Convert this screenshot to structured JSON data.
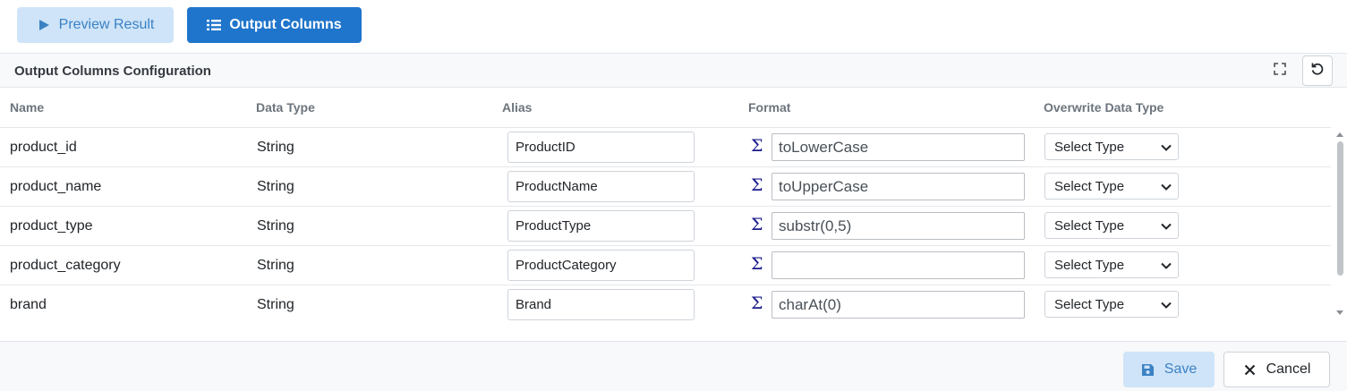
{
  "toolbar": {
    "preview_label": "Preview Result",
    "output_label": "Output Columns"
  },
  "panel": {
    "title": "Output Columns Configuration",
    "headers": {
      "name": "Name",
      "data_type": "Data Type",
      "alias": "Alias",
      "format": "Format",
      "overwrite": "Overwrite Data Type"
    }
  },
  "rows": [
    {
      "name": "product_id",
      "data_type": "String",
      "alias": "ProductID",
      "format": "toLowerCase",
      "overwrite": "Select Type"
    },
    {
      "name": "product_name",
      "data_type": "String",
      "alias": "ProductName",
      "format": "toUpperCase",
      "overwrite": "Select Type"
    },
    {
      "name": "product_type",
      "data_type": "String",
      "alias": "ProductType",
      "format": "substr(0,5)",
      "overwrite": "Select Type"
    },
    {
      "name": "product_category",
      "data_type": "String",
      "alias": "ProductCategory",
      "format": "",
      "overwrite": "Select Type"
    },
    {
      "name": "brand",
      "data_type": "String",
      "alias": "Brand",
      "format": "charAt(0)",
      "overwrite": "Select Type"
    }
  ],
  "sigma_symbol": "Σ",
  "footer": {
    "save_label": "Save",
    "cancel_label": "Cancel"
  },
  "icons": {
    "preview": "play-icon",
    "output": "list-icon",
    "expand": "expand-icon",
    "reset": "reset-icon",
    "save": "floppy-disk-icon",
    "cancel": "close-icon",
    "format": "sigma-icon",
    "select": "chevron-down-icon"
  },
  "colors": {
    "primary": "#1f75cb",
    "primary_light": "#cfe4f8",
    "primary_light_text": "#3b82c4"
  }
}
